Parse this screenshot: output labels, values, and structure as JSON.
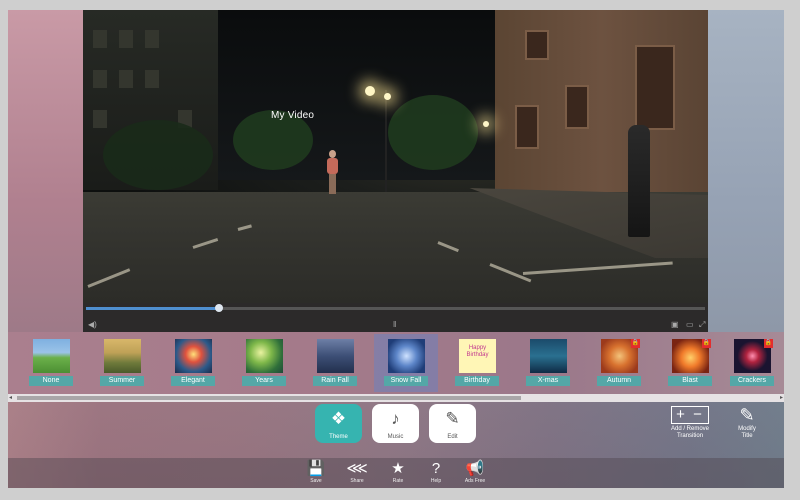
{
  "video": {
    "title_overlay": "My Video",
    "progress": 0.215
  },
  "themes": [
    {
      "label": "None",
      "locked": false,
      "selected": false
    },
    {
      "label": "Summer",
      "locked": false,
      "selected": false
    },
    {
      "label": "Elegant",
      "locked": false,
      "selected": false
    },
    {
      "label": "Years",
      "locked": false,
      "selected": false
    },
    {
      "label": "Rain Fall",
      "locked": false,
      "selected": false
    },
    {
      "label": "Snow Fall",
      "locked": false,
      "selected": true
    },
    {
      "label": "Birthday",
      "locked": false,
      "selected": false
    },
    {
      "label": "X-mas",
      "locked": false,
      "selected": false
    },
    {
      "label": "Autumn",
      "locked": true,
      "selected": false
    },
    {
      "label": "Blast",
      "locked": true,
      "selected": false
    },
    {
      "label": "Crackers",
      "locked": true,
      "selected": false
    }
  ],
  "birthday_thumb_text": "Happy Birthday",
  "modes": {
    "theme": "Theme",
    "music": "Music",
    "edit": "Edit",
    "active": "Theme"
  },
  "tools": {
    "add_remove": "Add / Remove Transition",
    "modify_title": "Modify Title"
  },
  "bottom_bar": {
    "save": "Save",
    "share": "Share",
    "rate": "Rate",
    "help": "Help",
    "ads_free": "Ads Free"
  },
  "colors": {
    "accent": "#36b4b0",
    "theme_label_bg": "#54a7a7",
    "lock": "#e32d2d",
    "seek_fill": "#4f8fd0"
  }
}
